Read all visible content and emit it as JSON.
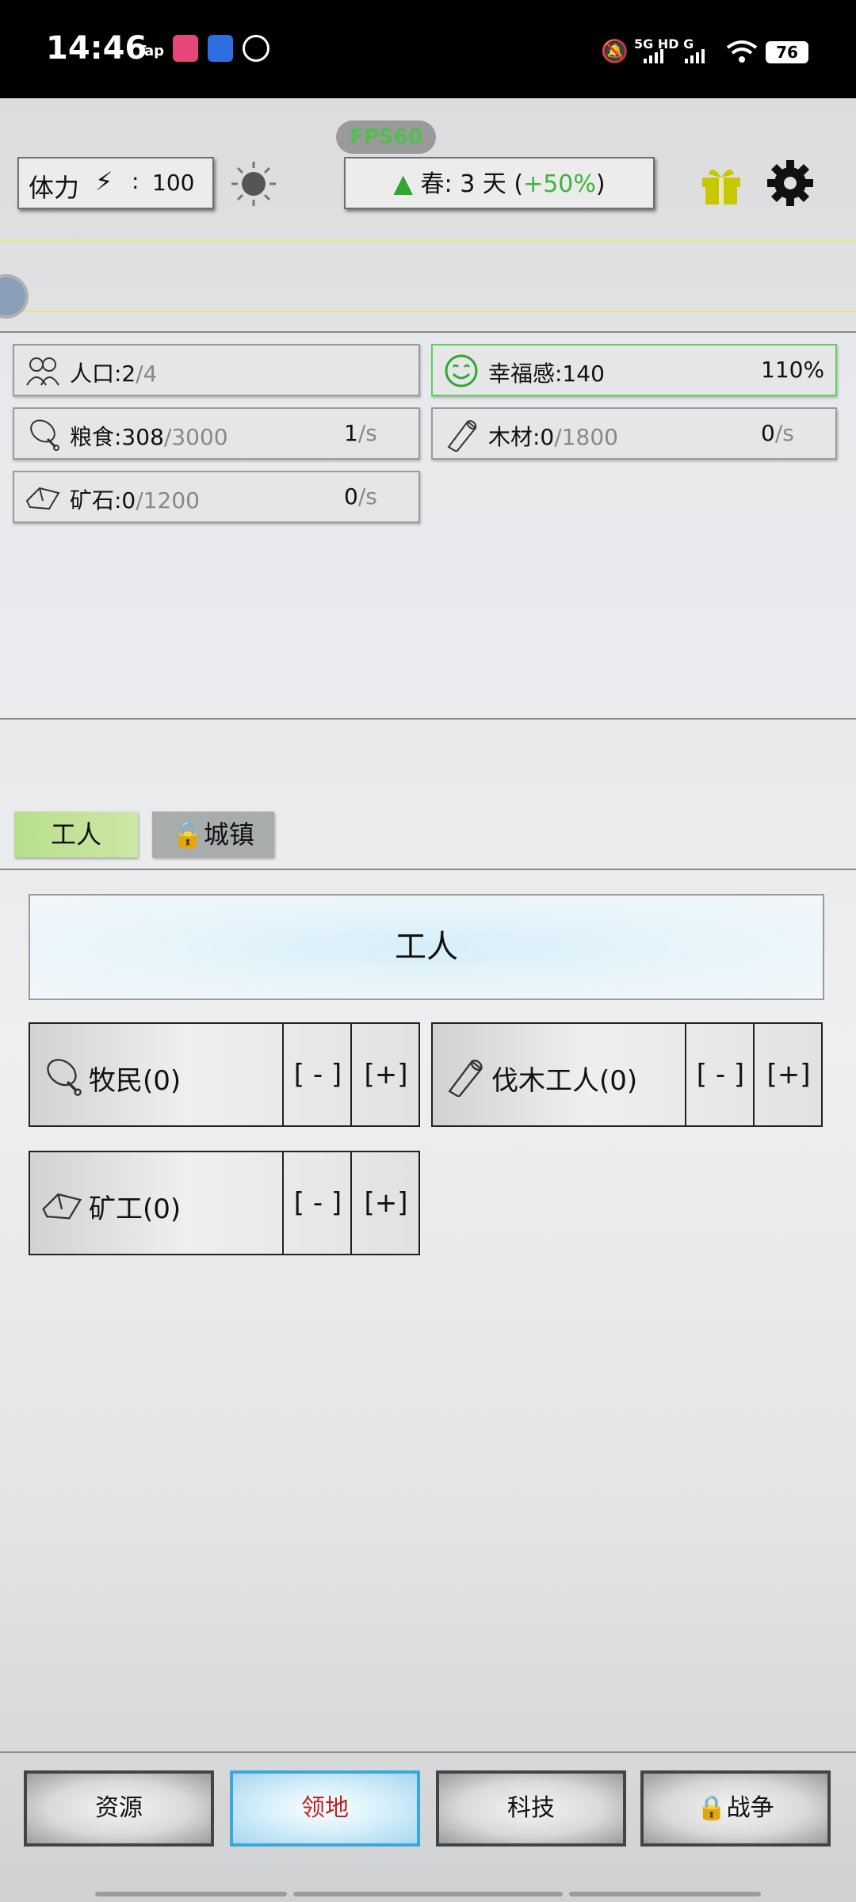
{
  "status_bar": {
    "time": "14:46",
    "tap_label": "Tap",
    "network": "5G HD G",
    "battery": "76"
  },
  "top": {
    "fps": "FPS60",
    "stamina_label": "体力",
    "stamina_sep": ":",
    "stamina_value": "100",
    "season_text": "春: 3 天 (",
    "season_bonus": "+50%",
    "season_close": ")"
  },
  "resources": {
    "population": {
      "label": "人口:2",
      "cap": "/4"
    },
    "happiness": {
      "label": "幸福感:140",
      "pct": "110%"
    },
    "food": {
      "label": "粮食:308",
      "cap": "/3000",
      "rate": "1",
      "unit": "/s"
    },
    "wood": {
      "label": "木材:0",
      "cap": "/1800",
      "rate": "0",
      "unit": "/s"
    },
    "ore": {
      "label": "矿石:0",
      "cap": "/1200",
      "rate": "0",
      "unit": "/s"
    }
  },
  "tabs": {
    "workers": "工人",
    "town": "城镇"
  },
  "workers": {
    "header": "工人",
    "minus": "[ - ]",
    "plus": "[+]",
    "herder": "牧民(0)",
    "lumberjack": "伐木工人(0)",
    "miner": "矿工(0)"
  },
  "nav": {
    "resources": "资源",
    "territory": "领地",
    "tech": "科技",
    "war": "战争"
  },
  "colors": {
    "accent_green": "#3cb43c",
    "gift_yellow": "#c8c800",
    "active_tab": "#a6d86f",
    "nav_active_border": "#3aa7e0"
  }
}
